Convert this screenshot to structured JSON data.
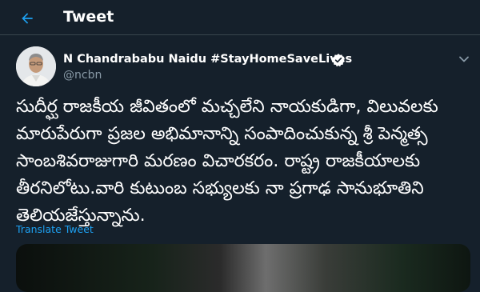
{
  "header": {
    "title": "Tweet"
  },
  "tweet": {
    "author_name": "N Chandrababu Naidu #StayHomeSaveLives",
    "handle": "@ncbn",
    "lines": [
      "సుదీర్ఘ రాజకీయ జీవితంలో మచ్చలేని నాయకుడిగా, విలువలకు",
      "మారుపేరుగా ప్రజల అభిమానాన్ని సంపాదించుకున్న శ్రీ పెన్మత్స",
      "సాంబశివరాజుగారి మరణం విచారకరం. రాష్ట్ర రాజకీయాలకు",
      "తీరనిలోటు.వారి కుటుంబ సభ్యులకు నా ప్రగాఢ సానుభూతిని",
      "తెలియజేస్తున్నాను."
    ],
    "translate_label": "Translate Tweet"
  },
  "colors": {
    "background": "#15202b",
    "accent": "#1da1f2",
    "secondary_text": "#8899a6"
  },
  "icons": {
    "back": "arrow-left-icon",
    "verified": "verified-badge-icon",
    "more": "chevron-down-icon"
  }
}
